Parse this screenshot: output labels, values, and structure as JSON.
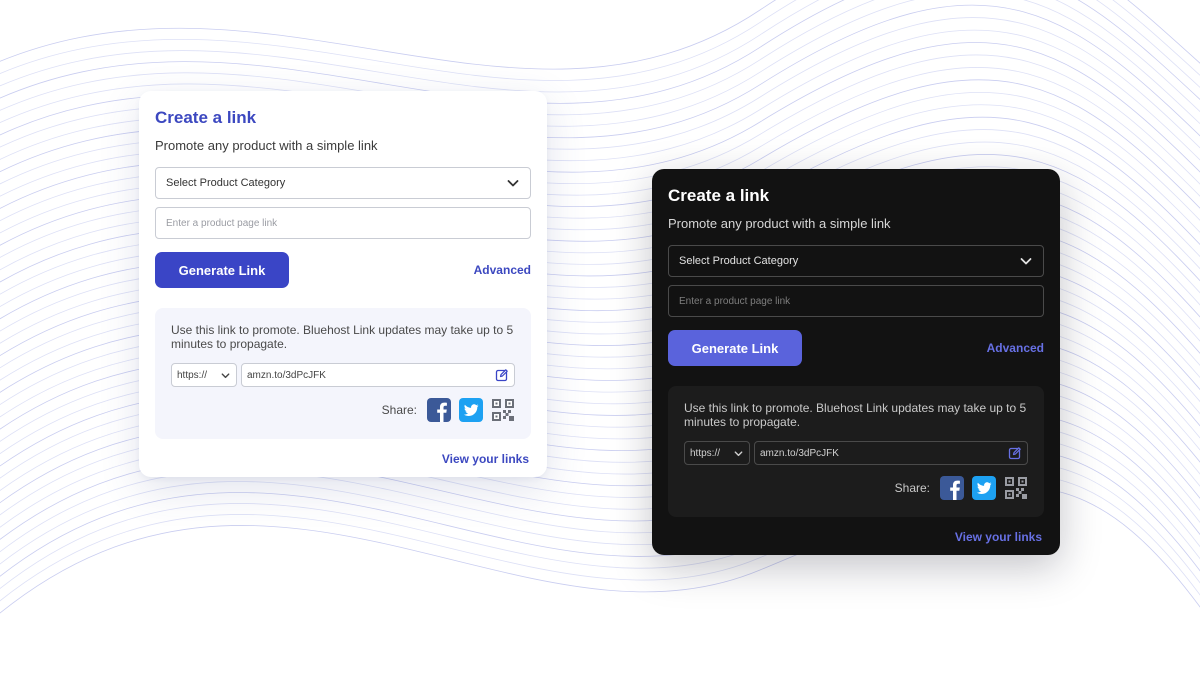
{
  "colors": {
    "accent_light": "#3a45c6",
    "accent_dark": "#5a63dc",
    "dark_card_bg": "#121212",
    "facebook": "#3b5998",
    "twitter": "#1da1f2"
  },
  "light_card": {
    "title": "Create a link",
    "subtitle": "Promote any product with a simple link",
    "category_select": "Select Product Category",
    "product_link_placeholder": "Enter a product page link",
    "generate_button": "Generate Link",
    "advanced_link": "Advanced",
    "note": "Use this link to promote. Bluehost Link updates may take up to 5 minutes to propagate.",
    "protocol": "https://",
    "short_url": "amzn.to/3dPcJFK",
    "share_label": "Share:",
    "view_links": "View your links"
  },
  "dark_card": {
    "title": "Create a link",
    "subtitle": "Promote any product with a simple link",
    "category_select": "Select Product Category",
    "product_link_placeholder": "Enter a product page link",
    "generate_button": "Generate Link",
    "advanced_link": "Advanced",
    "note": "Use this link to promote. Bluehost Link updates may take up to 5 minutes to propagate.",
    "protocol": "https://",
    "short_url": "amzn.to/3dPcJFK",
    "share_label": "Share:",
    "view_links": "View your links"
  },
  "icons": {
    "select_chevron": "chevron-down-icon",
    "edit": "edit-icon",
    "facebook": "facebook-icon",
    "twitter": "twitter-icon",
    "qr": "qr-code-icon"
  }
}
